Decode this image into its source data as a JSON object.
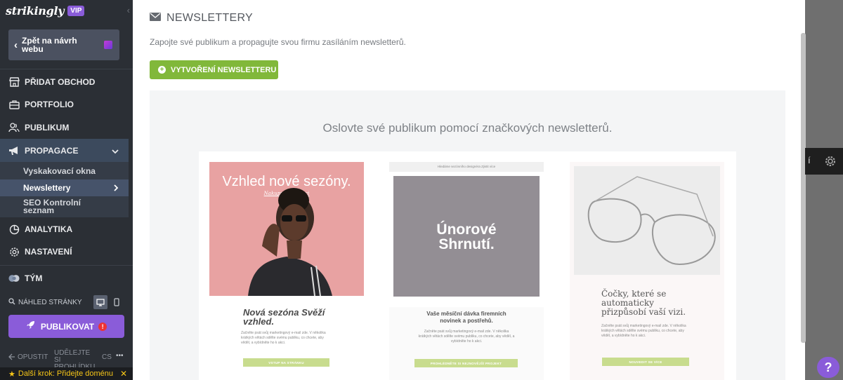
{
  "sidebar": {
    "logo": "strikingly",
    "vip_badge": "VIP",
    "back_button": "Zpět na návrh webu",
    "items": [
      {
        "label": "PŘIDAT OBCHOD",
        "icon": "store-icon"
      },
      {
        "label": "PORTFOLIO",
        "icon": "briefcase-icon"
      },
      {
        "label": "PUBLIKUM",
        "icon": "audience-icon"
      },
      {
        "label": "PROPAGACE",
        "icon": "megaphone-icon"
      },
      {
        "label": "ANALYTIKA",
        "icon": "pie-chart-icon"
      },
      {
        "label": "NASTAVENÍ",
        "icon": "gear-icon"
      },
      {
        "label": "TÝM",
        "icon": "team-icon"
      }
    ],
    "sub_items": [
      "Vyskakovací okna",
      "Newslettery",
      "SEO Kontrolní seznam"
    ],
    "preview_label": "NÁHLED STRÁNKY",
    "publish_button": "PUBLIKOVAT",
    "publish_warning": "!",
    "bottom": {
      "exit": "OPUSTIT",
      "shares": "UDĚLEJTE SI PROHLÍDKU",
      "lang": "CS",
      "more": "•••"
    },
    "next_step": "Další krok: Přidejte doménu"
  },
  "main": {
    "title": "NEWSLETTERY",
    "subtitle": "Zapojte své publikum a propagujte svou firmu zasíláním newsletterů.",
    "create_button": "VYTVOŘENÍ NEWSLETTERU",
    "tagline": "Oslovte své publikum pomocí značkových newsletterů.",
    "templates": [
      {
        "hero": "Vzhled nové sezóny.",
        "hero_link": "Nakupujte kolekci",
        "heading": "Nová sezóna Svěží vzhled.",
        "body": "Začněte psát svůj marketingový e-mail zde. V několika krátkých větách sdělte svému publiku, co chcete, aby věděl, a vybídněte ho k akci.",
        "cta": "VSTUP NA STRÁNKU"
      },
      {
        "top_bar": "Hledáme sezónního designéra  Zjistit více",
        "hero": "Únorové Shrnutí.",
        "heading": "Vaše měsíční dávka firemních novinek a postřehů.",
        "body": "Začněte psát svůj marketingový e-mail zde. V několika krátkých větách sdělte svému publiku, co chcete, aby věděl, a vybídněte ho k akci.",
        "cta": "PROHLÉDNĚTE SI NEJNOVĚJŠÍ PROJEKT"
      },
      {
        "heading": "Čočky, které se automaticky přizpůsobí vaší vizi.",
        "body": "Začněte psát svůj marketingový e-mail zde. V několika krátkých větách sdělte svému publiku, co chcete, aby věděl, a vybídněte ho k akci.",
        "cta": "NOUVEDIT SE VÍCE"
      }
    ]
  },
  "overlay": {
    "tab_char": "í",
    "help": "?"
  },
  "colors": {
    "accent_purple": "#8a5cd9",
    "green": "#81b83a",
    "sidebar_bg": "#2b2f35"
  }
}
